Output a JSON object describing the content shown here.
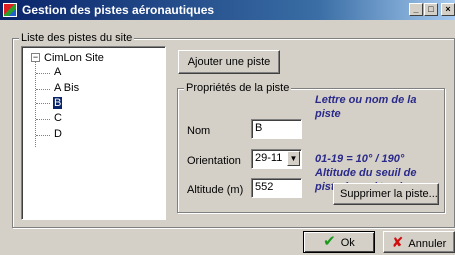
{
  "window": {
    "title": "Gestion des pistes aéronautiques",
    "controls": {
      "minimize": "_",
      "maximize": "□",
      "close": "×"
    }
  },
  "runway_list": {
    "legend": "Liste des pistes du site",
    "root": "CimLon Site",
    "expander": "−",
    "items": [
      "A",
      "A Bis",
      "B",
      "C",
      "D"
    ],
    "selected": "B"
  },
  "buttons": {
    "add": "Ajouter une piste",
    "delete": "Supprimer la piste...",
    "ok": "Ok",
    "cancel": "Annuler"
  },
  "properties": {
    "legend": "Propriétés de la piste",
    "name_label": "Nom",
    "name_value": "B",
    "name_hint": "Lettre ou nom de la piste",
    "orientation_label": "Orientation",
    "orientation_value": "29-11",
    "orientation_hint": "01-19 = 10° / 190°",
    "altitude_label": "Altitude (m)",
    "altitude_value": "552",
    "altitude_hint": "Altitude du seuil de piste (en mètres)"
  }
}
